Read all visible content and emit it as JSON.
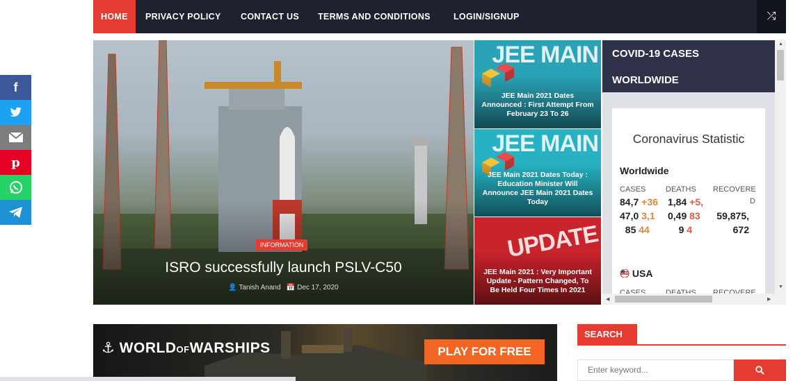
{
  "nav": {
    "items": [
      {
        "label": "HOME",
        "active": true
      },
      {
        "label": "PRIVACY POLICY"
      },
      {
        "label": "CONTACT US"
      },
      {
        "label": "TERMS AND CONDITIONS"
      },
      {
        "label": "LOGIN/SIGNUP"
      }
    ],
    "shuffle_icon": "shuffle-icon"
  },
  "share": [
    {
      "icon": "facebook-icon",
      "glyph": "f",
      "color": "#3b5998"
    },
    {
      "icon": "twitter-icon",
      "glyph": "🐦",
      "color": "#1da1f2"
    },
    {
      "icon": "email-icon",
      "glyph": "✉",
      "color": "#7d7d7d"
    },
    {
      "icon": "pinterest-icon",
      "glyph": "𝓅",
      "color": "#e60023"
    },
    {
      "icon": "whatsapp-icon",
      "glyph": "✆",
      "color": "#25d366"
    },
    {
      "icon": "telegram-icon",
      "glyph": "➤",
      "color": "#1e90d4"
    }
  ],
  "hero": {
    "tag": "INFORMATION",
    "title": "ISRO successfully launch PSLV-C50",
    "author": "Tanish Anand",
    "date": "Dec 17, 2020"
  },
  "side_posts": [
    {
      "title": "JEE Main 2021 Dates Announced : First Attempt From February 23 To 26",
      "bg_text": "JEE MAIN",
      "bg": "#2aa3b6"
    },
    {
      "title": "JEE Main 2021 Dates Today : Education Minister Will Announce JEE Main 2021 Dates Today",
      "bg_text": "JEE MAIN",
      "bg": "#27b1c2"
    },
    {
      "title": "JEE Main 2021 : Very Important Update - Pattern Changed, To Be Held Four Times In 2021",
      "bg_text": "UPDATE",
      "bg": "#c9232b"
    }
  ],
  "covid": {
    "header_line1": "COVID-19 CASES",
    "header_line2": "WORLDWIDE",
    "heading": "Coronavirus Statistic",
    "worldwide": {
      "label": "Worldwide",
      "columns": [
        "CASES",
        "DEATHS",
        "RECOVERE",
        "D"
      ],
      "cases": {
        "a": "84,7",
        "b": "+36",
        "c": "47,0",
        "d": "3,1",
        "e": "85",
        "f": "44"
      },
      "deaths": {
        "a": "1,84",
        "b": "+5,",
        "c": "0,49",
        "d": "83",
        "e": "9",
        "f": "4"
      },
      "recovered": {
        "a": "59,875,",
        "b": "672"
      }
    },
    "usa": {
      "flag_icon": "usa-flag-icon",
      "label": "USA",
      "columns": [
        "CASES",
        "DEATHS",
        "RECOVERE"
      ]
    }
  },
  "ad": {
    "logo_main": "WORLD",
    "logo_of": "OF",
    "logo_end": "WARSHIPS",
    "cta": "PLAY FOR FREE"
  },
  "search": {
    "title": "SEARCH",
    "placeholder": "Enter keyword...",
    "button_icon": "search-icon"
  }
}
